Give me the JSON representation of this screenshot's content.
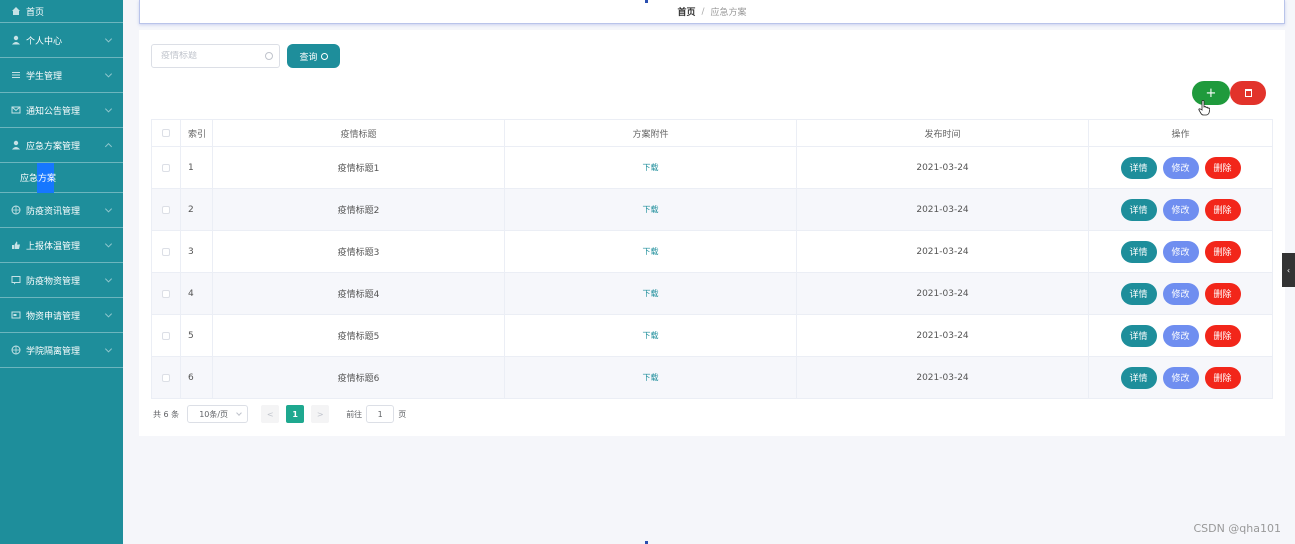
{
  "sidebar": {
    "items": [
      {
        "label": "首页"
      },
      {
        "label": "个人中心"
      },
      {
        "label": "学生管理"
      },
      {
        "label": "通知公告管理"
      },
      {
        "label": "应急方案管理"
      },
      {
        "label": "防疫资讯管理"
      },
      {
        "label": "上报体温管理"
      },
      {
        "label": "防疫物资管理"
      },
      {
        "label": "物资申请管理"
      },
      {
        "label": "学院隔离管理"
      }
    ],
    "active_sub": "应急方案"
  },
  "breadcrumb": {
    "home": "首页",
    "sep": "/",
    "current": "应急方案"
  },
  "search": {
    "placeholder": "疫情标题",
    "button_label": "查询"
  },
  "toolbar": {
    "add_label": "+"
  },
  "table": {
    "headers": {
      "index": "索引",
      "title": "疫情标题",
      "file": "方案附件",
      "date": "发布时间",
      "action": "操作"
    },
    "rows": [
      {
        "index": "1",
        "title": "疫情标题1",
        "file": "下载",
        "date": "2021-03-24"
      },
      {
        "index": "2",
        "title": "疫情标题2",
        "file": "下载",
        "date": "2021-03-24"
      },
      {
        "index": "3",
        "title": "疫情标题3",
        "file": "下载",
        "date": "2021-03-24"
      },
      {
        "index": "4",
        "title": "疫情标题4",
        "file": "下载",
        "date": "2021-03-24"
      },
      {
        "index": "5",
        "title": "疫情标题5",
        "file": "下载",
        "date": "2021-03-24"
      },
      {
        "index": "6",
        "title": "疫情标题6",
        "file": "下载",
        "date": "2021-03-24"
      }
    ],
    "actions": {
      "detail": "详情",
      "edit": "修改",
      "delete": "删除"
    }
  },
  "pager": {
    "total": "共 6 条",
    "page_size": "10条/页",
    "prev": "<",
    "current": "1",
    "next": ">",
    "goto_label": "前往",
    "goto_value": "1",
    "page_unit": "页"
  },
  "watermark": "CSDN @qha101",
  "colors": {
    "sidebar": "#1e8e9b",
    "primary": "#1e8e9b",
    "add": "#1f9a3c",
    "danger": "#e2332b",
    "edit": "#6f8ef0",
    "page_active": "#1ea88f"
  }
}
